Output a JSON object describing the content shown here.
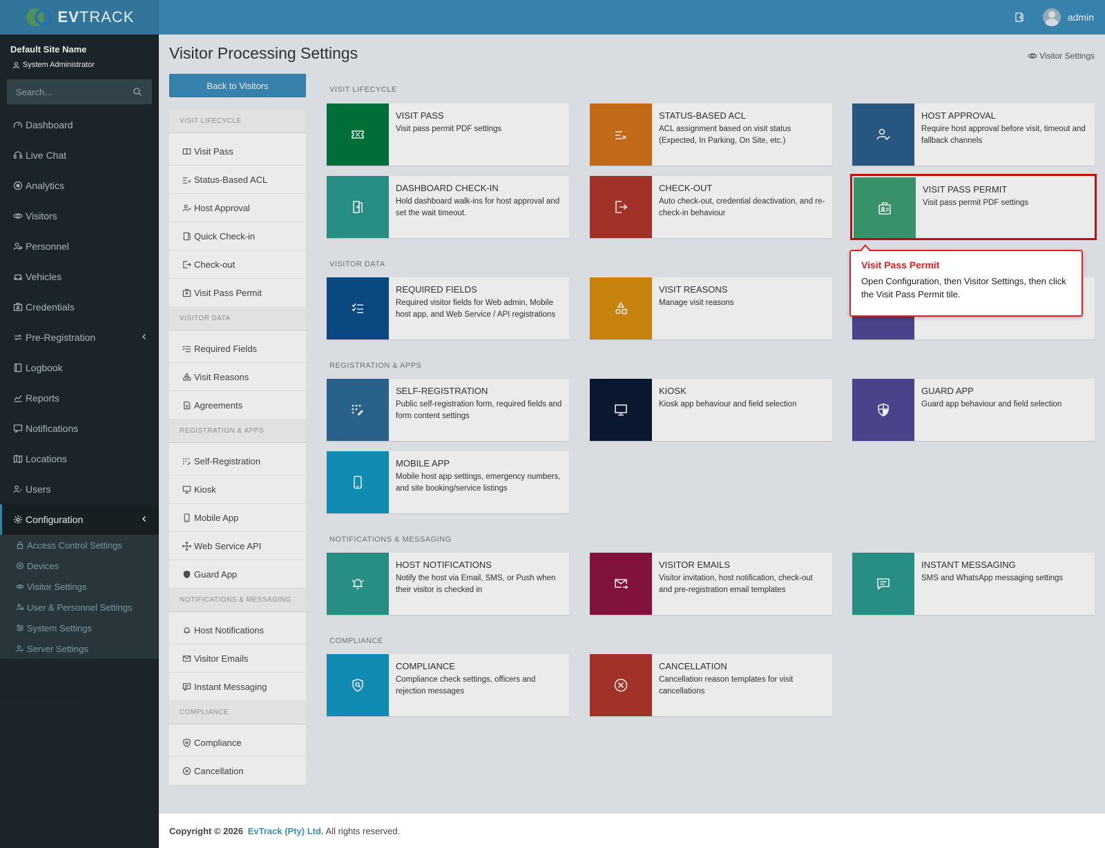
{
  "header": {
    "brand_bold": "EV",
    "brand_rest": "TRACK",
    "user_name": "admin"
  },
  "sidebar": {
    "site_name": "Default Site Name",
    "role": "System Administrator",
    "search_placeholder": "Search...",
    "items": [
      {
        "label": "Dashboard",
        "icon": "gauge-icon"
      },
      {
        "label": "Live Chat",
        "icon": "headset-icon"
      },
      {
        "label": "Analytics",
        "icon": "target-icon"
      },
      {
        "label": "Visitors",
        "icon": "eye-icon"
      },
      {
        "label": "Personnel",
        "icon": "user-cog-icon"
      },
      {
        "label": "Vehicles",
        "icon": "car-icon"
      },
      {
        "label": "Credentials",
        "icon": "id-card-icon"
      },
      {
        "label": "Pre-Registration",
        "icon": "arrows-icon"
      },
      {
        "label": "Logbook",
        "icon": "book-icon"
      },
      {
        "label": "Reports",
        "icon": "chart-icon"
      },
      {
        "label": "Notifications",
        "icon": "message-icon"
      },
      {
        "label": "Locations",
        "icon": "map-icon"
      },
      {
        "label": "Users",
        "icon": "users-icon"
      },
      {
        "label": "Configuration",
        "icon": "gear-icon"
      }
    ],
    "config_sub": [
      "Access Control Settings",
      "Devices",
      "Visitor Settings",
      "User & Personnel Settings",
      "System Settings",
      "Server Settings"
    ]
  },
  "page": {
    "title": "Visitor Processing Settings",
    "breadcrumb": "Visitor Settings",
    "back_button": "Back to Visitors"
  },
  "subnav": {
    "sections": [
      {
        "title": "VISIT LIFECYCLE",
        "items": [
          "Visit Pass",
          "Status-Based ACL",
          "Host Approval",
          "Quick Check-in",
          "Check-out",
          "Visit Pass Permit"
        ]
      },
      {
        "title": "VISITOR DATA",
        "items": [
          "Required Fields",
          "Visit Reasons",
          "Agreements"
        ]
      },
      {
        "title": "REGISTRATION & APPS",
        "items": [
          "Self-Registration",
          "Kiosk",
          "Mobile App",
          "Web Service API",
          "Guard App"
        ]
      },
      {
        "title": "NOTIFICATIONS & MESSAGING",
        "items": [
          "Host Notifications",
          "Visitor Emails",
          "Instant Messaging"
        ]
      },
      {
        "title": "COMPLIANCE",
        "items": [
          "Compliance",
          "Cancellation"
        ]
      }
    ]
  },
  "sections": {
    "lifecycle": "VISIT LIFECYCLE",
    "visitor_data": "VISITOR DATA",
    "registration": "REGISTRATION & APPS",
    "notifications": "NOTIFICATIONS & MESSAGING",
    "compliance": "COMPLIANCE"
  },
  "tiles": {
    "visit_pass": {
      "title": "VISIT PASS",
      "desc": "Visit pass permit PDF settings",
      "color": "#00793c"
    },
    "status_acl": {
      "title": "STATUS-BASED ACL",
      "desc": "ACL assignment based on visit status (Expected, In Parking, On Site, etc.)",
      "color": "#d4731c"
    },
    "host_approval": {
      "title": "HOST APPROVAL",
      "desc": "Require host approval before visit, timeout and fallback channels",
      "color": "#2b5f8c"
    },
    "dashboard_checkin": {
      "title": "DASHBOARD CHECK-IN",
      "desc": "Hold dashboard walk-ins for host approval and set the wait timeout.",
      "color": "#2c9a8f"
    },
    "checkout": {
      "title": "CHECK-OUT",
      "desc": "Auto check-out, credential deactivation, and re-check-in behaviour",
      "color": "#b0372b"
    },
    "visit_pass_permit": {
      "title": "VISIT PASS PERMIT",
      "desc": "Visit pass permit PDF settings",
      "color": "#3c9f73"
    },
    "required_fields": {
      "title": "REQUIRED FIELDS",
      "desc": "Required visitor fields for Web admin, Mobile host app, and Web Service / API registrations",
      "color": "#0b4f8c"
    },
    "visit_reasons": {
      "title": "VISIT REASONS",
      "desc": "Manage visit reasons",
      "color": "#d88c0f"
    },
    "self_registration": {
      "title": "SELF-REGISTRATION",
      "desc": "Public self-registration form, required fields and form content settings",
      "color": "#2e6a97"
    },
    "kiosk": {
      "title": "KIOSK",
      "desc": "Kiosk app behaviour and field selection",
      "color": "#0a1b33"
    },
    "guard_app": {
      "title": "GUARD APP",
      "desc": "Guard app behaviour and field selection",
      "color": "#514896"
    },
    "mobile_app": {
      "title": "MOBILE APP",
      "desc": "Mobile host app settings, emergency numbers, and site booking/service listings",
      "color": "#1396c4"
    },
    "host_notifications": {
      "title": "HOST NOTIFICATIONS",
      "desc": "Notify the host via Email, SMS, or Push when their visitor is checked in",
      "color": "#2c9a8f"
    },
    "visitor_emails": {
      "title": "VISITOR EMAILS",
      "desc": "Visitor invitation, host notification, check-out and pre-registration email templates",
      "color": "#8c1441"
    },
    "instant_messaging": {
      "title": "INSTANT MESSAGING",
      "desc": "SMS and WhatsApp messaging settings",
      "color": "#2c9a8f"
    },
    "compliance": {
      "title": "COMPLIANCE",
      "desc": "Compliance check settings, officers and rejection messages",
      "color": "#1396c4"
    },
    "cancellation": {
      "title": "CANCELLATION",
      "desc": "Cancellation reason templates for visit cancellations",
      "color": "#b0372b"
    }
  },
  "callout": {
    "title": "Visit Pass Permit",
    "text": "Open Configuration, then Visitor Settings, then click the Visit Pass Permit tile."
  },
  "footer": {
    "prefix": "Copyright © 2026",
    "company": "EvTrack (Pty) Ltd.",
    "suffix": "All rights reserved."
  }
}
